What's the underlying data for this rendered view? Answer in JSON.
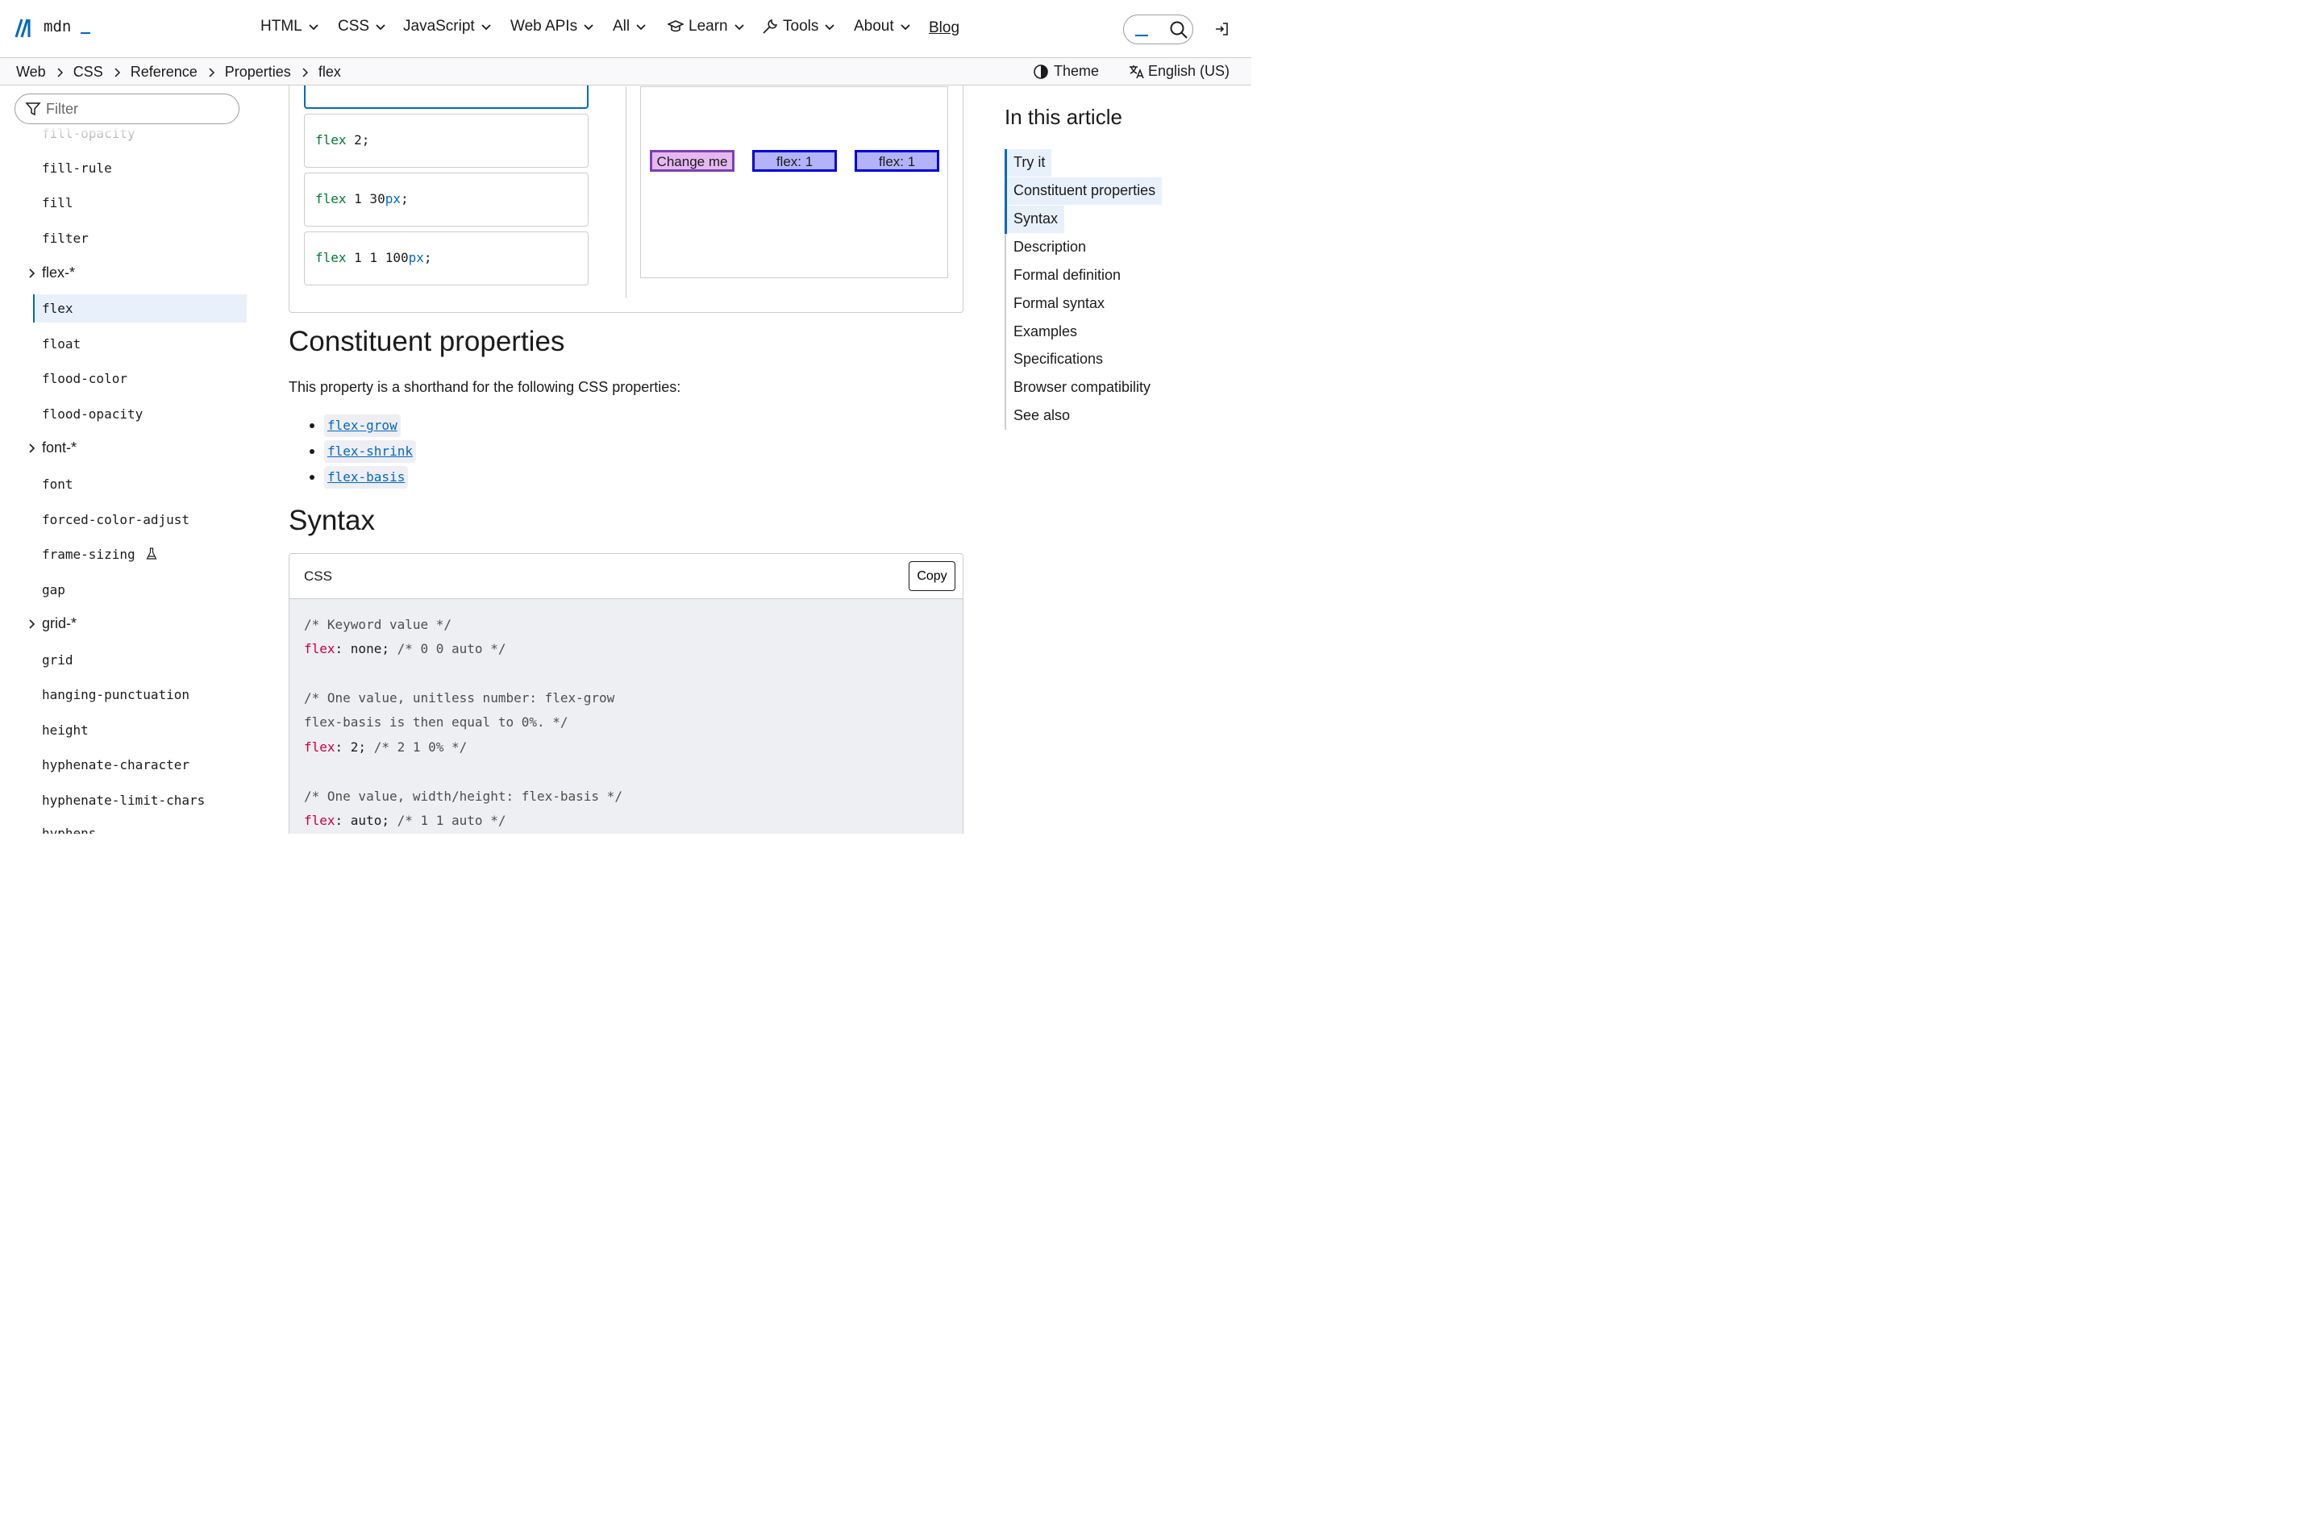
{
  "header": {
    "logo_text": "mdn",
    "nav": [
      "HTML",
      "CSS",
      "JavaScript",
      "Web APIs",
      "All",
      "Learn",
      "Tools",
      "About"
    ],
    "blog": "Blog",
    "accent": "#0069c2"
  },
  "breadcrumbs": [
    "Web",
    "CSS",
    "Reference",
    "Properties",
    "flex"
  ],
  "toolbar": {
    "theme": "Theme",
    "language": "English (US)"
  },
  "sidebar": {
    "filter_placeholder": "Filter",
    "partial_top": "fill-opacity",
    "items": [
      "fill-rule",
      "fill",
      "filter",
      "flex-*",
      "flex",
      "float",
      "flood-color",
      "flood-opacity",
      "font-*",
      "font",
      "forced-color-adjust",
      "frame-sizing",
      "gap",
      "grid-*",
      "grid",
      "hanging-punctuation",
      "height",
      "hyphenate-character",
      "hyphenate-limit-chars",
      "hyphens"
    ],
    "active": "flex"
  },
  "tryit": {
    "choices": [
      {
        "prop": "flex",
        "value": " 2;"
      },
      {
        "prop": "flex",
        "value": " 1 30",
        "unit": "px",
        "end": ";"
      },
      {
        "prop": "flex",
        "value": " 1 1 100",
        "unit": "px",
        "end": ";"
      }
    ],
    "output": [
      "Change me",
      "flex: 1",
      "flex: 1"
    ]
  },
  "content": {
    "h_constituent": "Constituent properties",
    "shorthand": "This property is a shorthand for the following CSS properties:",
    "links": [
      "flex-grow",
      "flex-shrink",
      "flex-basis"
    ],
    "h_syntax": "Syntax",
    "code_lang": "CSS",
    "copy": "Copy",
    "code": {
      "l1": "/* Keyword value */",
      "l2_kw": "flex",
      "l2_rest": ": none; ",
      "l2_cm": "/* 0 0 auto */",
      "l3": "/* One value, unitless number: flex-grow",
      "l4": "flex-basis is then equal to 0%. */",
      "l5_kw": "flex",
      "l5_rest": ": 2; ",
      "l5_cm": "/* 2 1 0% */",
      "l6": "/* One value, width/height: flex-basis */",
      "l7_kw": "flex",
      "l7_rest": ": auto; ",
      "l7_cm": "/* 1 1 auto */"
    }
  },
  "toc": {
    "title": "In this article",
    "items": [
      "Try it",
      "Constituent properties",
      "Syntax",
      "Description",
      "Formal definition",
      "Formal syntax",
      "Examples",
      "Specifications",
      "Browser compatibility",
      "See also"
    ]
  }
}
